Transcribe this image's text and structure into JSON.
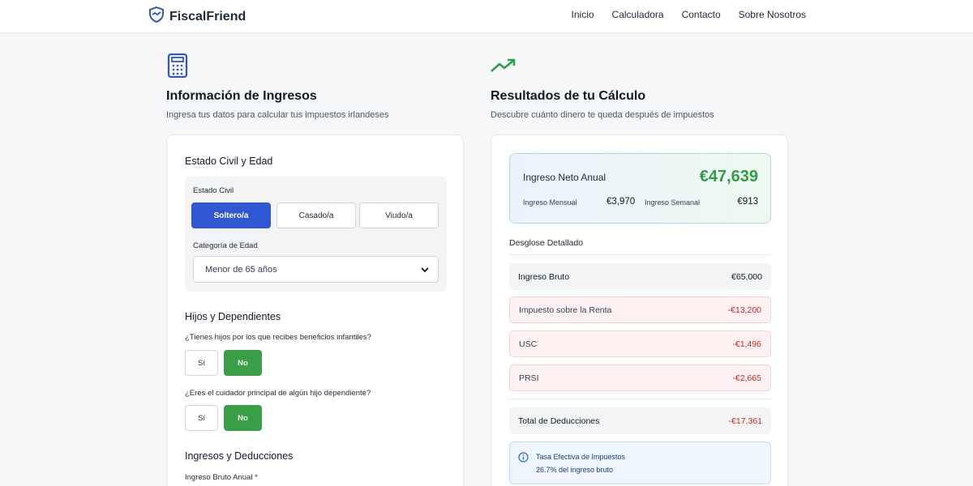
{
  "nav": {
    "brand": "FiscalFriend",
    "links": [
      "Inicio",
      "Calculadora",
      "Contacto",
      "Sobre Nosotros"
    ]
  },
  "income": {
    "title": "Información de Ingresos",
    "subtitle": "Ingresa tus datos para calcular tus impuestos irlandeses",
    "marital_section": "Estado Civil y Edad",
    "marital_label": "Estado Civil",
    "marital_options": [
      "Soltero/a",
      "Casado/a",
      "Viudo/a"
    ],
    "marital_selected": "Soltero/a",
    "age_label": "Categoría de Edad",
    "age_value": "Menor de 65 años",
    "children_section": "Hijos y Dependientes",
    "q1": "¿Tienes hijos por los que recibes beneficios infantiles?",
    "q2": "¿Eres el cuidador principal de algún hijo dependiente?",
    "yes": "Sí",
    "no": "No",
    "q1_selected": "No",
    "q2_selected": "No",
    "income_section": "Ingresos y Deducciones",
    "gross_label": "Ingreso Bruto Anual *"
  },
  "results": {
    "title": "Resultados de tu Cálculo",
    "subtitle": "Descubre cuánto dinero te queda después de impuestos",
    "net_label": "Ingreso Neto Anual",
    "net_value": "€47,639",
    "monthly_label": "Ingreso Mensual",
    "monthly_value": "€3,970",
    "weekly_label": "Ingreso Semanal",
    "weekly_value": "€913",
    "breakdown_title": "Desglose Detallado",
    "rows": [
      {
        "label": "Ingreso Bruto",
        "value": "€65,000"
      },
      {
        "label": "Impuesto sobre la Renta",
        "value": "-€13,200"
      },
      {
        "label": "USC",
        "value": "-€1,496"
      },
      {
        "label": "PRSI",
        "value": "-€2,665"
      }
    ],
    "total_label": "Total de Deducciones",
    "total_value": "-€17,361",
    "rate_title": "Tasa Efectiva de Impuestos",
    "rate_value": "26.7% del ingreso bruto"
  },
  "colors": {
    "primary": "#3056d3",
    "success": "#3a9e47",
    "danger": "#c62828"
  }
}
